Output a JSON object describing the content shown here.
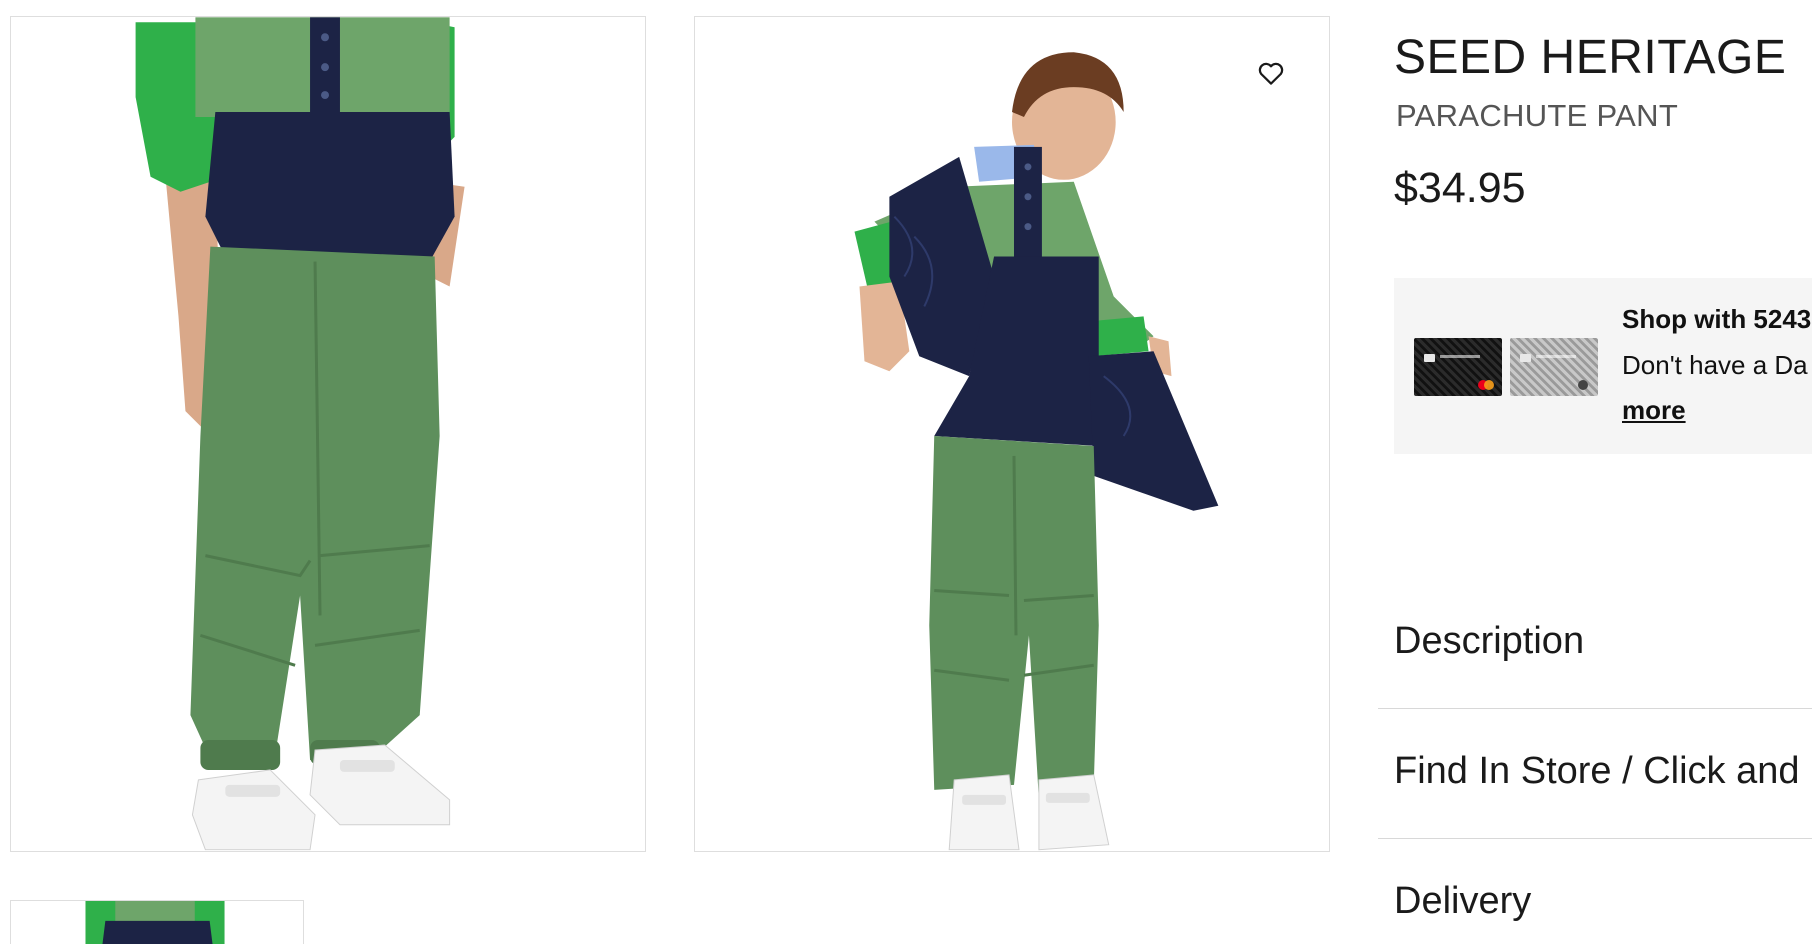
{
  "product": {
    "brand": "SEED HERITAGE",
    "name": "PARACHUTE PANT",
    "price": "$34.95"
  },
  "gallery": {
    "images": [
      {
        "alt": "Child wearing green parachute pants and white velcro sneakers, cropped view"
      },
      {
        "alt": "Child in navy quilted vest, green fleece and green parachute pants"
      }
    ],
    "thumbnails": [
      {
        "alt": "Thumbnail of product image 1"
      }
    ],
    "wishlist_icon": "heart-outline-icon"
  },
  "promo": {
    "title": "Shop with 5243",
    "subtitle": "Don't have a Da",
    "link": "more",
    "card_colors": [
      "#141414",
      "#b4b4b4"
    ]
  },
  "accordions": [
    {
      "label": "Description"
    },
    {
      "label": "Find In Store / Click and"
    },
    {
      "label": "Delivery"
    }
  ],
  "colors": {
    "pants_green": "#5e8f5c",
    "fleece_green": "#2fb04a",
    "navy": "#1c2345",
    "frame_border": "#dedede",
    "promo_bg": "#f5f5f5"
  }
}
